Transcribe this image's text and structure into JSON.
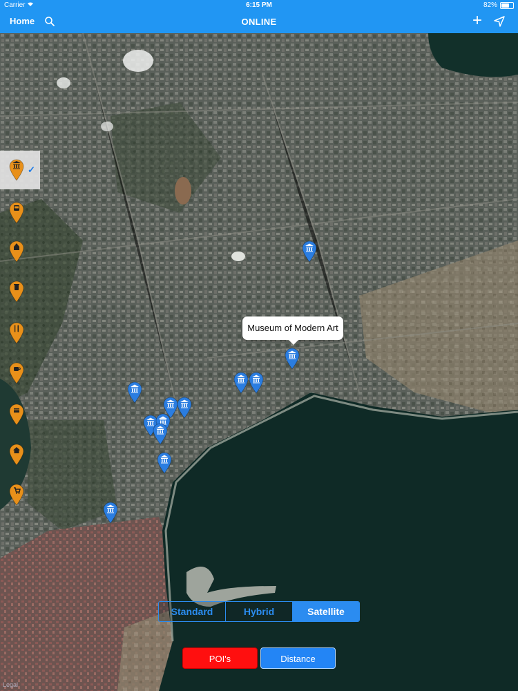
{
  "status": {
    "carrier": "Carrier",
    "time": "6:15 PM",
    "battery": "82%",
    "battery_level": 0.82
  },
  "nav": {
    "home_label": "Home",
    "title": "ONLINE",
    "icons": [
      "search-icon",
      "plus-icon",
      "location-arrow-icon"
    ]
  },
  "map": {
    "view": "satellite",
    "callout": {
      "title": "Museum of Modern Art"
    },
    "poi_icon": "museum-icon",
    "pin_color": "#2b7de0"
  },
  "categories": [
    {
      "icon": "museum-icon",
      "selected": true
    },
    {
      "icon": "bus-icon",
      "selected": false
    },
    {
      "icon": "church-icon",
      "selected": false
    },
    {
      "icon": "trash-icon",
      "selected": false
    },
    {
      "icon": "restaurant-icon",
      "selected": false
    },
    {
      "icon": "coffee-icon",
      "selected": false
    },
    {
      "icon": "shopping-icon",
      "selected": false
    },
    {
      "icon": "home-icon",
      "selected": false
    },
    {
      "icon": "cart-icon",
      "selected": false
    }
  ],
  "map_types": {
    "options": [
      "Standard",
      "Hybrid",
      "Satellite"
    ],
    "selected": "Satellite"
  },
  "buttons": {
    "pois": "POI's",
    "distance": "Distance"
  },
  "colors": {
    "nav_bar": "#2196f3",
    "category_pin": "#e8901a",
    "poi_button": "#ff0f0f",
    "distance_button": "#2385f5"
  },
  "legal": "Legal"
}
